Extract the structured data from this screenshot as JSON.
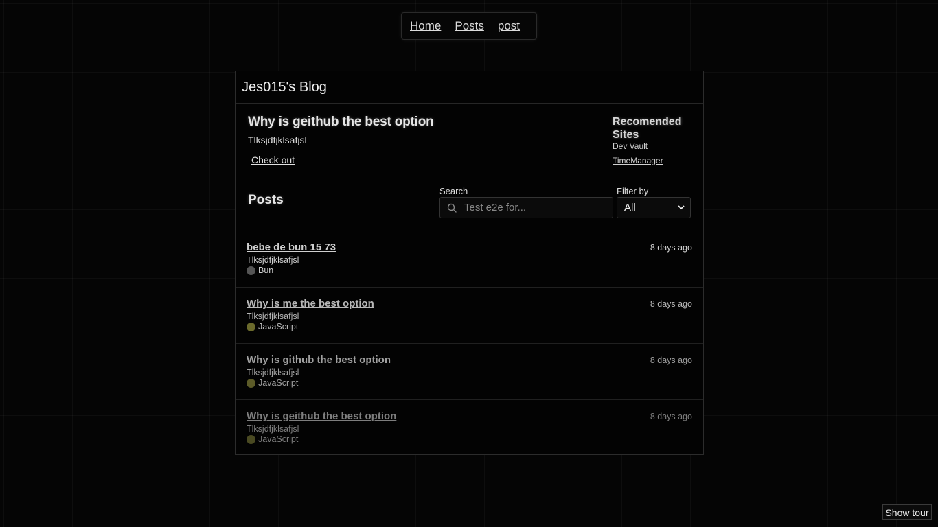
{
  "nav": {
    "links": [
      "Home",
      "Posts",
      "post"
    ]
  },
  "blog": {
    "title": "Jes015's Blog"
  },
  "featured": {
    "title": "Why is geithub the best option",
    "description": "Tlksjdfjklsafjsl",
    "link_label": "Check out"
  },
  "recommended": {
    "title": "Recomended Sites",
    "links": [
      "Dev Vault",
      "TimeManager"
    ]
  },
  "posts_section": {
    "heading": "Posts",
    "search": {
      "label": "Search",
      "placeholder": "Test e2e for..."
    },
    "filter": {
      "label": "Filter by",
      "selected": "All"
    }
  },
  "posts": [
    {
      "title": "bebe de bun 15 73",
      "description": "Tlksjdfjklsafjsl",
      "tag": "Bun",
      "tag_color": "#555555",
      "time": "8 days ago"
    },
    {
      "title": "Why is me the best option",
      "description": "Tlksjdfjklsafjsl",
      "tag": "JavaScript",
      "tag_color": "#6b6a2c",
      "time": "8 days ago"
    },
    {
      "title": "Why is github the best option",
      "description": "Tlksjdfjklsafjsl",
      "tag": "JavaScript",
      "tag_color": "#5c5b28",
      "time": "8 days ago"
    },
    {
      "title": "Why is geithub the best option",
      "description": "Tlksjdfjklsafjsl",
      "tag": "JavaScript",
      "tag_color": "#4a4a22",
      "time": "8 days ago"
    }
  ],
  "tour": {
    "label": "Show tour"
  }
}
